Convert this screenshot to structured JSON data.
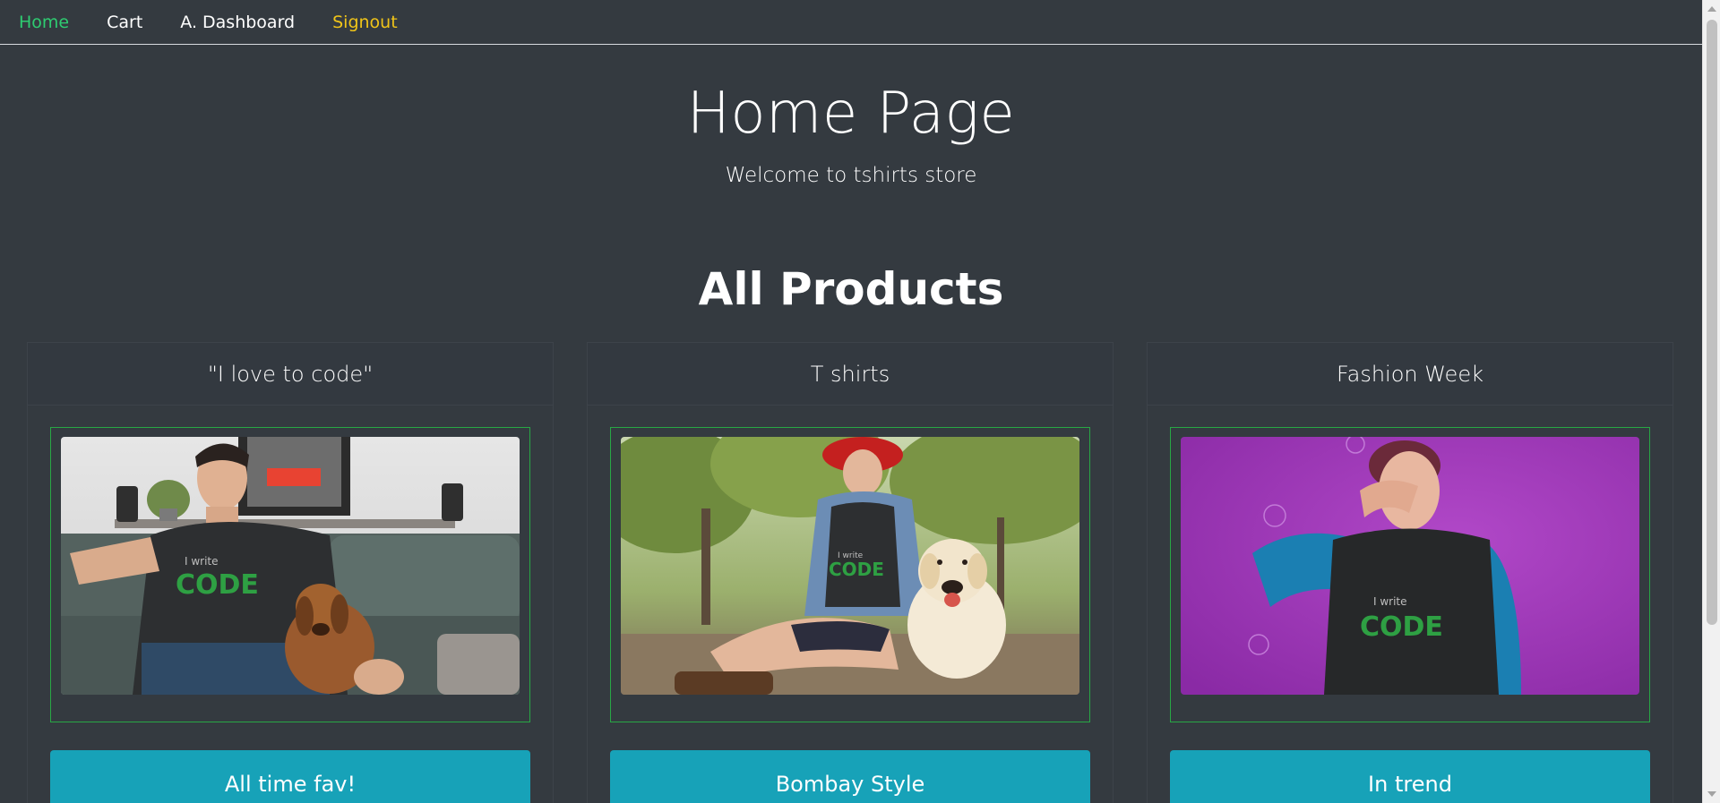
{
  "nav": {
    "items": [
      {
        "label": "Home",
        "state": "active",
        "color": "#2ecc71"
      },
      {
        "label": "Cart",
        "state": "default",
        "color": "#ffffff"
      },
      {
        "label": "A. Dashboard",
        "state": "default",
        "color": "#ffffff"
      },
      {
        "label": "Signout",
        "state": "warning",
        "color": "#f0c419"
      }
    ]
  },
  "hero": {
    "title": "Home Page",
    "subtitle": "Welcome to tshirts store"
  },
  "section": {
    "title": "All Products"
  },
  "products": [
    {
      "title": "\"I love to code\"",
      "button_label": "All time fav!",
      "image_icon": "man-with-dog-on-couch-photo"
    },
    {
      "title": "T shirts",
      "button_label": "Bombay Style",
      "image_icon": "woman-with-dog-in-park-photo"
    },
    {
      "title": "Fashion Week",
      "button_label": "In trend",
      "image_icon": "woman-on-purple-background-photo"
    }
  ],
  "colors": {
    "background": "#343a40",
    "accent_button": "#17a2b8",
    "image_border": "#28a745"
  }
}
